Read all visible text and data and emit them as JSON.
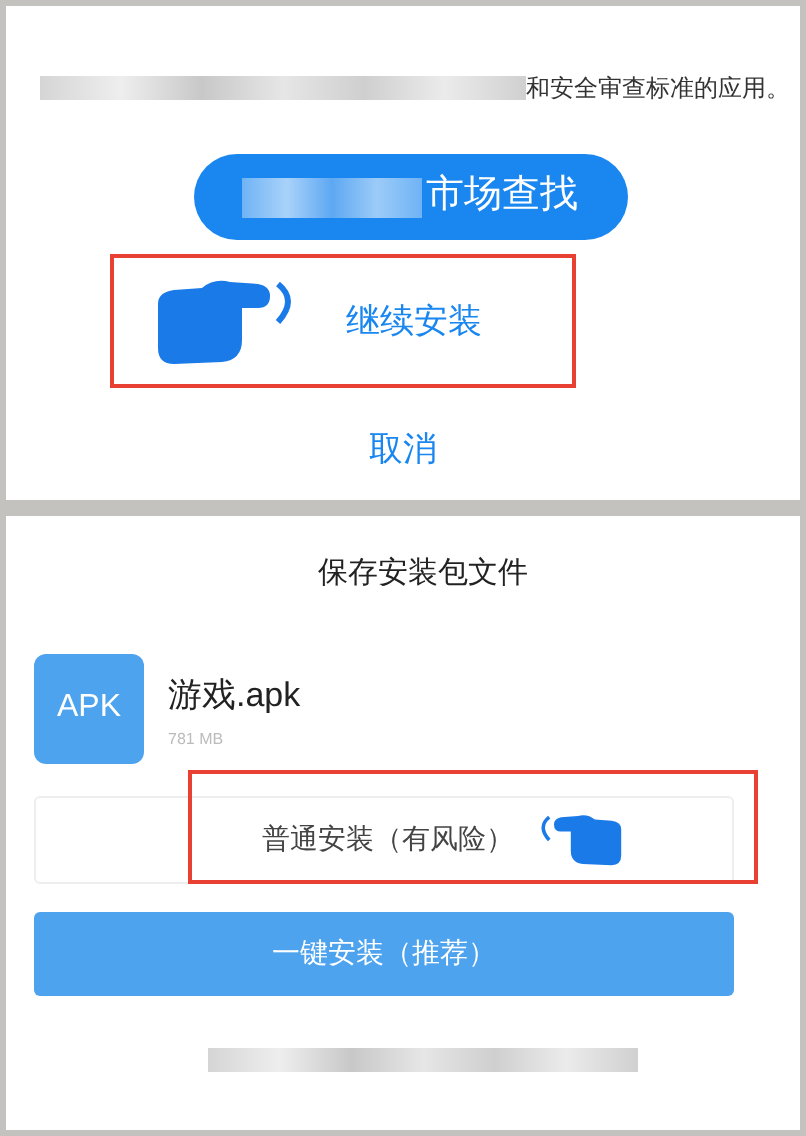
{
  "top_dialog": {
    "notice": "和安全审查标准的应用。",
    "market_button": "市场查找",
    "continue_button": "继续安装",
    "cancel_button": "取消"
  },
  "bottom_dialog": {
    "title": "保存安装包文件",
    "file": {
      "icon_label": "APK",
      "name": "游戏.apk",
      "size": "781 MB"
    },
    "normal_install_button": "普通安装（有风险）",
    "one_click_button": "一键安装（推荐）"
  }
}
